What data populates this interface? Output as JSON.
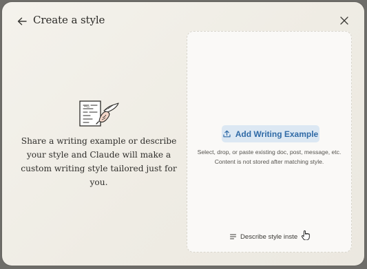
{
  "dialog": {
    "title": "Create a style",
    "back_icon": "arrow-left-icon",
    "close_icon": "close-icon"
  },
  "intro": {
    "illustration": "writing-hand-illustration",
    "text": "Share a writing example or describe your style and Claude will make a custom writing style tailored just for you."
  },
  "drop_zone": {
    "add_button_label": "Add Writing Example",
    "add_button_icon": "upload-icon",
    "hint_line1": "Select, drop, or paste existing doc, post, message, etc.",
    "hint_line2": "Content is not stored after matching style.",
    "describe_label": "Describe style inste",
    "describe_icon": "text-lines-icon"
  },
  "colors": {
    "accent": "#2f6aa6",
    "accent_bg": "#dce8f3"
  }
}
